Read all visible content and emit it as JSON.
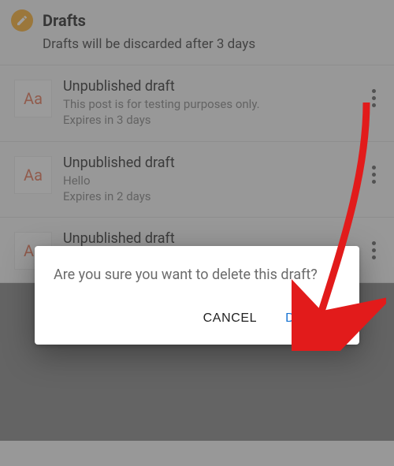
{
  "header": {
    "title": "Drafts",
    "subtitle": "Drafts will be discarded after 3 days"
  },
  "thumb_label": "Aa",
  "drafts": [
    {
      "title": "Unpublished draft",
      "preview": "This post is for testing purposes only.",
      "expires": "Expires in 3 days"
    },
    {
      "title": "Unpublished draft",
      "preview": "Hello",
      "expires": "Expires in 2 days"
    },
    {
      "title": "Unpublished draft",
      "preview": "",
      "expires": ""
    }
  ],
  "dialog": {
    "message": "Are you sure you want to delete this draft?",
    "cancel": "CANCEL",
    "delete": "DELETE"
  },
  "colors": {
    "accent_orange": "#f5a623",
    "accent_blue": "#1874d2",
    "arrow_red": "#e21b1b"
  }
}
